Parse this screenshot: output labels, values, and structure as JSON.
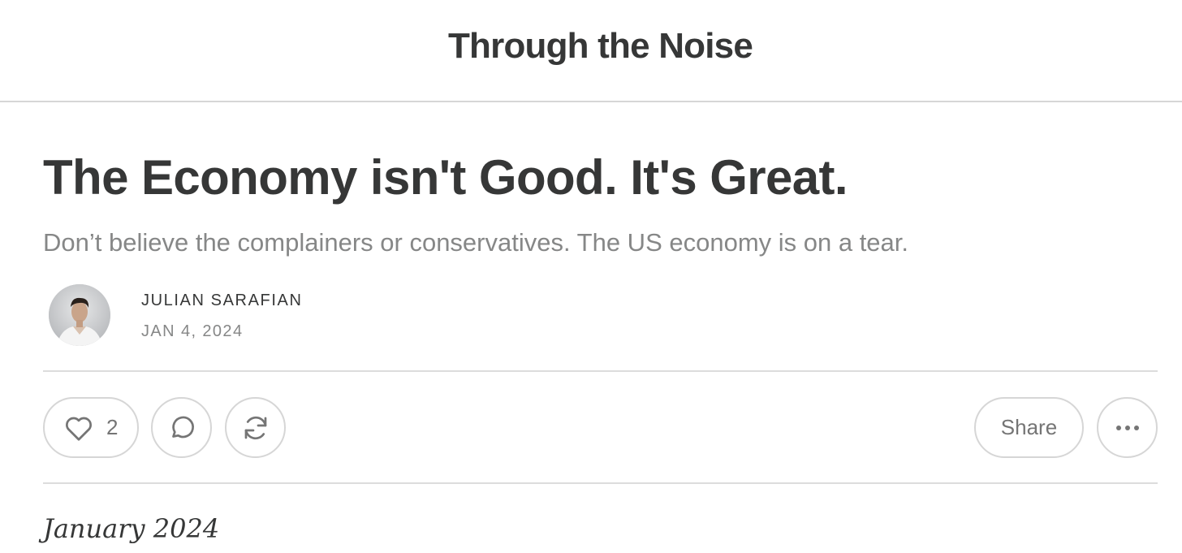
{
  "publication": {
    "name": "Through the Noise"
  },
  "post": {
    "title": "The Economy isn't Good. It's Great.",
    "subtitle": "Don’t believe the complainers or conservatives. The US economy is on a tear.",
    "author": "JULIAN SARAFIAN",
    "date": "JAN 4, 2024",
    "avatar_icon": "author-avatar"
  },
  "actions": {
    "like_count": "2",
    "like_icon": "heart-icon",
    "comment_icon": "speech-bubble-icon",
    "restack_icon": "refresh-arrows-icon",
    "share_label": "Share",
    "more_icon": "ellipsis-icon"
  },
  "body": {
    "first_line": "January 2024"
  },
  "colors": {
    "text": "#363737",
    "muted": "#868787",
    "border": "#d6d6d6"
  }
}
